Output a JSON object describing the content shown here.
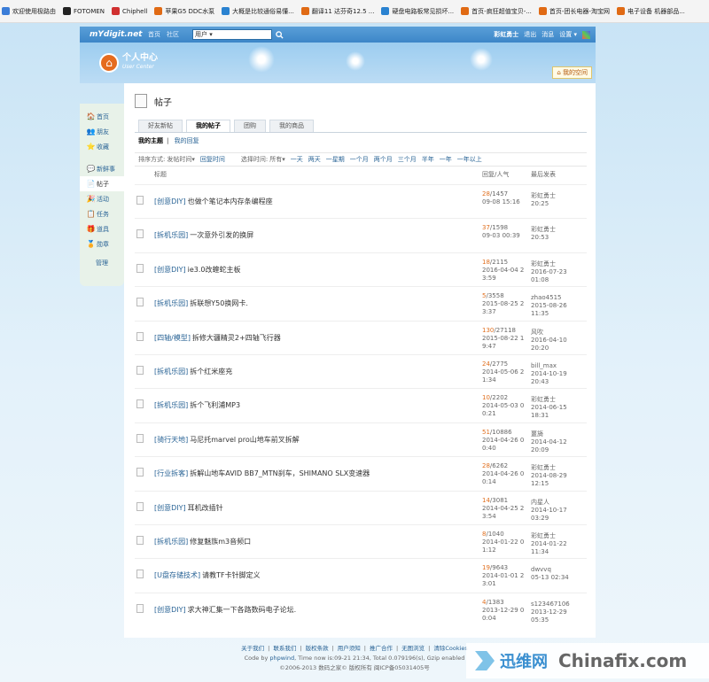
{
  "bookmarks": [
    {
      "label": "欢迎使用极路由",
      "color": "#3b7dd8"
    },
    {
      "label": "FOTOMEN",
      "color": "#222"
    },
    {
      "label": "Chiphell",
      "color": "#d03030"
    },
    {
      "label": "苹果G5 DDC水泵",
      "color": "#e06a14"
    },
    {
      "label": "大概是比较通俗易懂...",
      "color": "#2a82d0"
    },
    {
      "label": "翻译11 达芬奇12.5 ...",
      "color": "#e06a14"
    },
    {
      "label": "硬盘电路板常见损坏...",
      "color": "#2a82d0"
    },
    {
      "label": "首页-疯狂超值宝贝-...",
      "color": "#e06a14"
    },
    {
      "label": "首页-团长电器-淘宝网",
      "color": "#e06a14"
    },
    {
      "label": "电子设备 机器部品...",
      "color": "#e06a14"
    }
  ],
  "topbar": {
    "logo": "mYdigit.net",
    "home": "首页",
    "community": "社区",
    "search_type": "用户",
    "user": "彩虹勇士",
    "logout": "退出",
    "messages": "消息",
    "settings": "设置"
  },
  "banner": {
    "title": "个人中心",
    "subtitle": "User Center",
    "my_space": "我的空间"
  },
  "sidebar": {
    "items": [
      {
        "label": "首页",
        "icon": "🏠"
      },
      {
        "label": "朋友",
        "icon": "👥"
      },
      {
        "label": "收藏",
        "icon": "⭐"
      },
      {
        "label": "新鲜事",
        "icon": "💬"
      },
      {
        "label": "帖子",
        "icon": "📄"
      },
      {
        "label": "活动",
        "icon": "🎉"
      },
      {
        "label": "任务",
        "icon": "📋"
      },
      {
        "label": "道具",
        "icon": "🎁"
      },
      {
        "label": "勋章",
        "icon": "🏅"
      }
    ],
    "manage": "管理"
  },
  "page": {
    "title": "帖子",
    "tabs": [
      "好友新帖",
      "我的帖子",
      "团购",
      "我的商品"
    ],
    "subtabs": [
      "我的主题",
      "我的回复"
    ],
    "sort_label": "排序方式:",
    "sort_options": [
      "发帖时间",
      "回复时间"
    ],
    "time_label": "选择时间:",
    "time_all": "所有",
    "time_options": [
      "一天",
      "两天",
      "一星期",
      "一个月",
      "两个月",
      "三个月",
      "半年",
      "一年",
      "一年以上"
    ],
    "col_title": "标题",
    "col_replies": "回复/人气",
    "col_last": "最后发表"
  },
  "posts": [
    {
      "cat": "[创意DIY]",
      "title": "也做个笔记本内存条编程座",
      "replies": "28",
      "views": "/1457",
      "date": "09-08 15:16",
      "last_user": "彩虹勇士",
      "last_time": "20:25"
    },
    {
      "cat": "[拆机乐园]",
      "title": "一次意外引发的换屏",
      "replies": "37",
      "views": "/1598",
      "date": "09-03 00:39",
      "last_user": "彩虹勇士",
      "last_time": "20:53"
    },
    {
      "cat": "[创意DIY]",
      "title": "ie3.0改蝰蛇主板",
      "replies": "18",
      "views": "/2115",
      "date": "2016-04-04 2 3:59",
      "last_user": "彩虹勇士",
      "last_time": "2016-07-23 01:08"
    },
    {
      "cat": "[拆机乐园]",
      "title": "拆联想Y50换网卡.",
      "replies": "5",
      "views": "/3558",
      "date": "2015-08-25 2 3:37",
      "last_user": "zhao4515",
      "last_time": "2015-08-26 11:35"
    },
    {
      "cat": "[四轴/模型]",
      "title": "拆修大疆精灵2+四轴飞行器",
      "replies": "130",
      "views": "/27118",
      "date": "2015-08-22 1 9:47",
      "last_user": "风吹",
      "last_time": "2016-04-10 20:20"
    },
    {
      "cat": "[拆机乐园]",
      "title": "拆个红米座充",
      "replies": "24",
      "views": "/2775",
      "date": "2014-05-06 2 1:34",
      "last_user": "bill_max",
      "last_time": "2014-10-19 20:43"
    },
    {
      "cat": "[拆机乐园]",
      "title": "拆个飞利浦MP3",
      "replies": "10",
      "views": "/2202",
      "date": "2014-05-03 0 0:21",
      "last_user": "彩虹勇士",
      "last_time": "2014-06-15 18:31"
    },
    {
      "cat": "[骑行天地]",
      "title": "马尼托marvel pro山地车前叉拆解",
      "replies": "51",
      "views": "/10886",
      "date": "2014-04-26 0 0:40",
      "last_user": "噩旖",
      "last_time": "2014-04-12 20:09"
    },
    {
      "cat": "[行业拆客]",
      "title": "拆解山地车AVID BB7_MTN刹车，SHIMANO SLX变速器",
      "replies": "28",
      "views": "/6262",
      "date": "2014-04-26 0 0:14",
      "last_user": "彩虹勇士",
      "last_time": "2014-08-29 12:15"
    },
    {
      "cat": "[创意DIY]",
      "title": "耳机改插针",
      "replies": "14",
      "views": "/3081",
      "date": "2014-04-25 2 3:54",
      "last_user": "内星人",
      "last_time": "2014-10-17 03:29"
    },
    {
      "cat": "[拆机乐园]",
      "title": "修复魅族m3音频口",
      "replies": "8",
      "views": "/1040",
      "date": "2014-01-22 0 1:12",
      "last_user": "彩虹勇士",
      "last_time": "2014-01-22 11:34"
    },
    {
      "cat": "[U盘存储技术]",
      "title": "请教TF卡针脚定义",
      "replies": "19",
      "views": "/9643",
      "date": "2014-01-01 2 3:01",
      "last_user": "dwvvq",
      "last_time": "05-13 02:34"
    },
    {
      "cat": "[创意DIY]",
      "title": "求大神汇集一下各路数码电子论坛.",
      "replies": "4",
      "views": "/1383",
      "date": "2013-12-29 0 0:04",
      "last_user": "s123467106",
      "last_time": "2013-12-29 05:35"
    }
  ],
  "footer": {
    "links": [
      "关于我们",
      "联系我们",
      "版权条款",
      "用户须知",
      "推广合作",
      "无图浏览",
      "清除Cookies"
    ],
    "code_by": "Code by",
    "phpwind": "phpwind",
    "time_info": ", Time now is:09-21 21:34, Total 0.079196(s), Gzip enabled",
    "copyright": "©2006-2013 数码之家© 版权所有 闽ICP备05031405号"
  },
  "watermark": {
    "cn": "迅维网",
    "en": "Chinafix.com"
  }
}
